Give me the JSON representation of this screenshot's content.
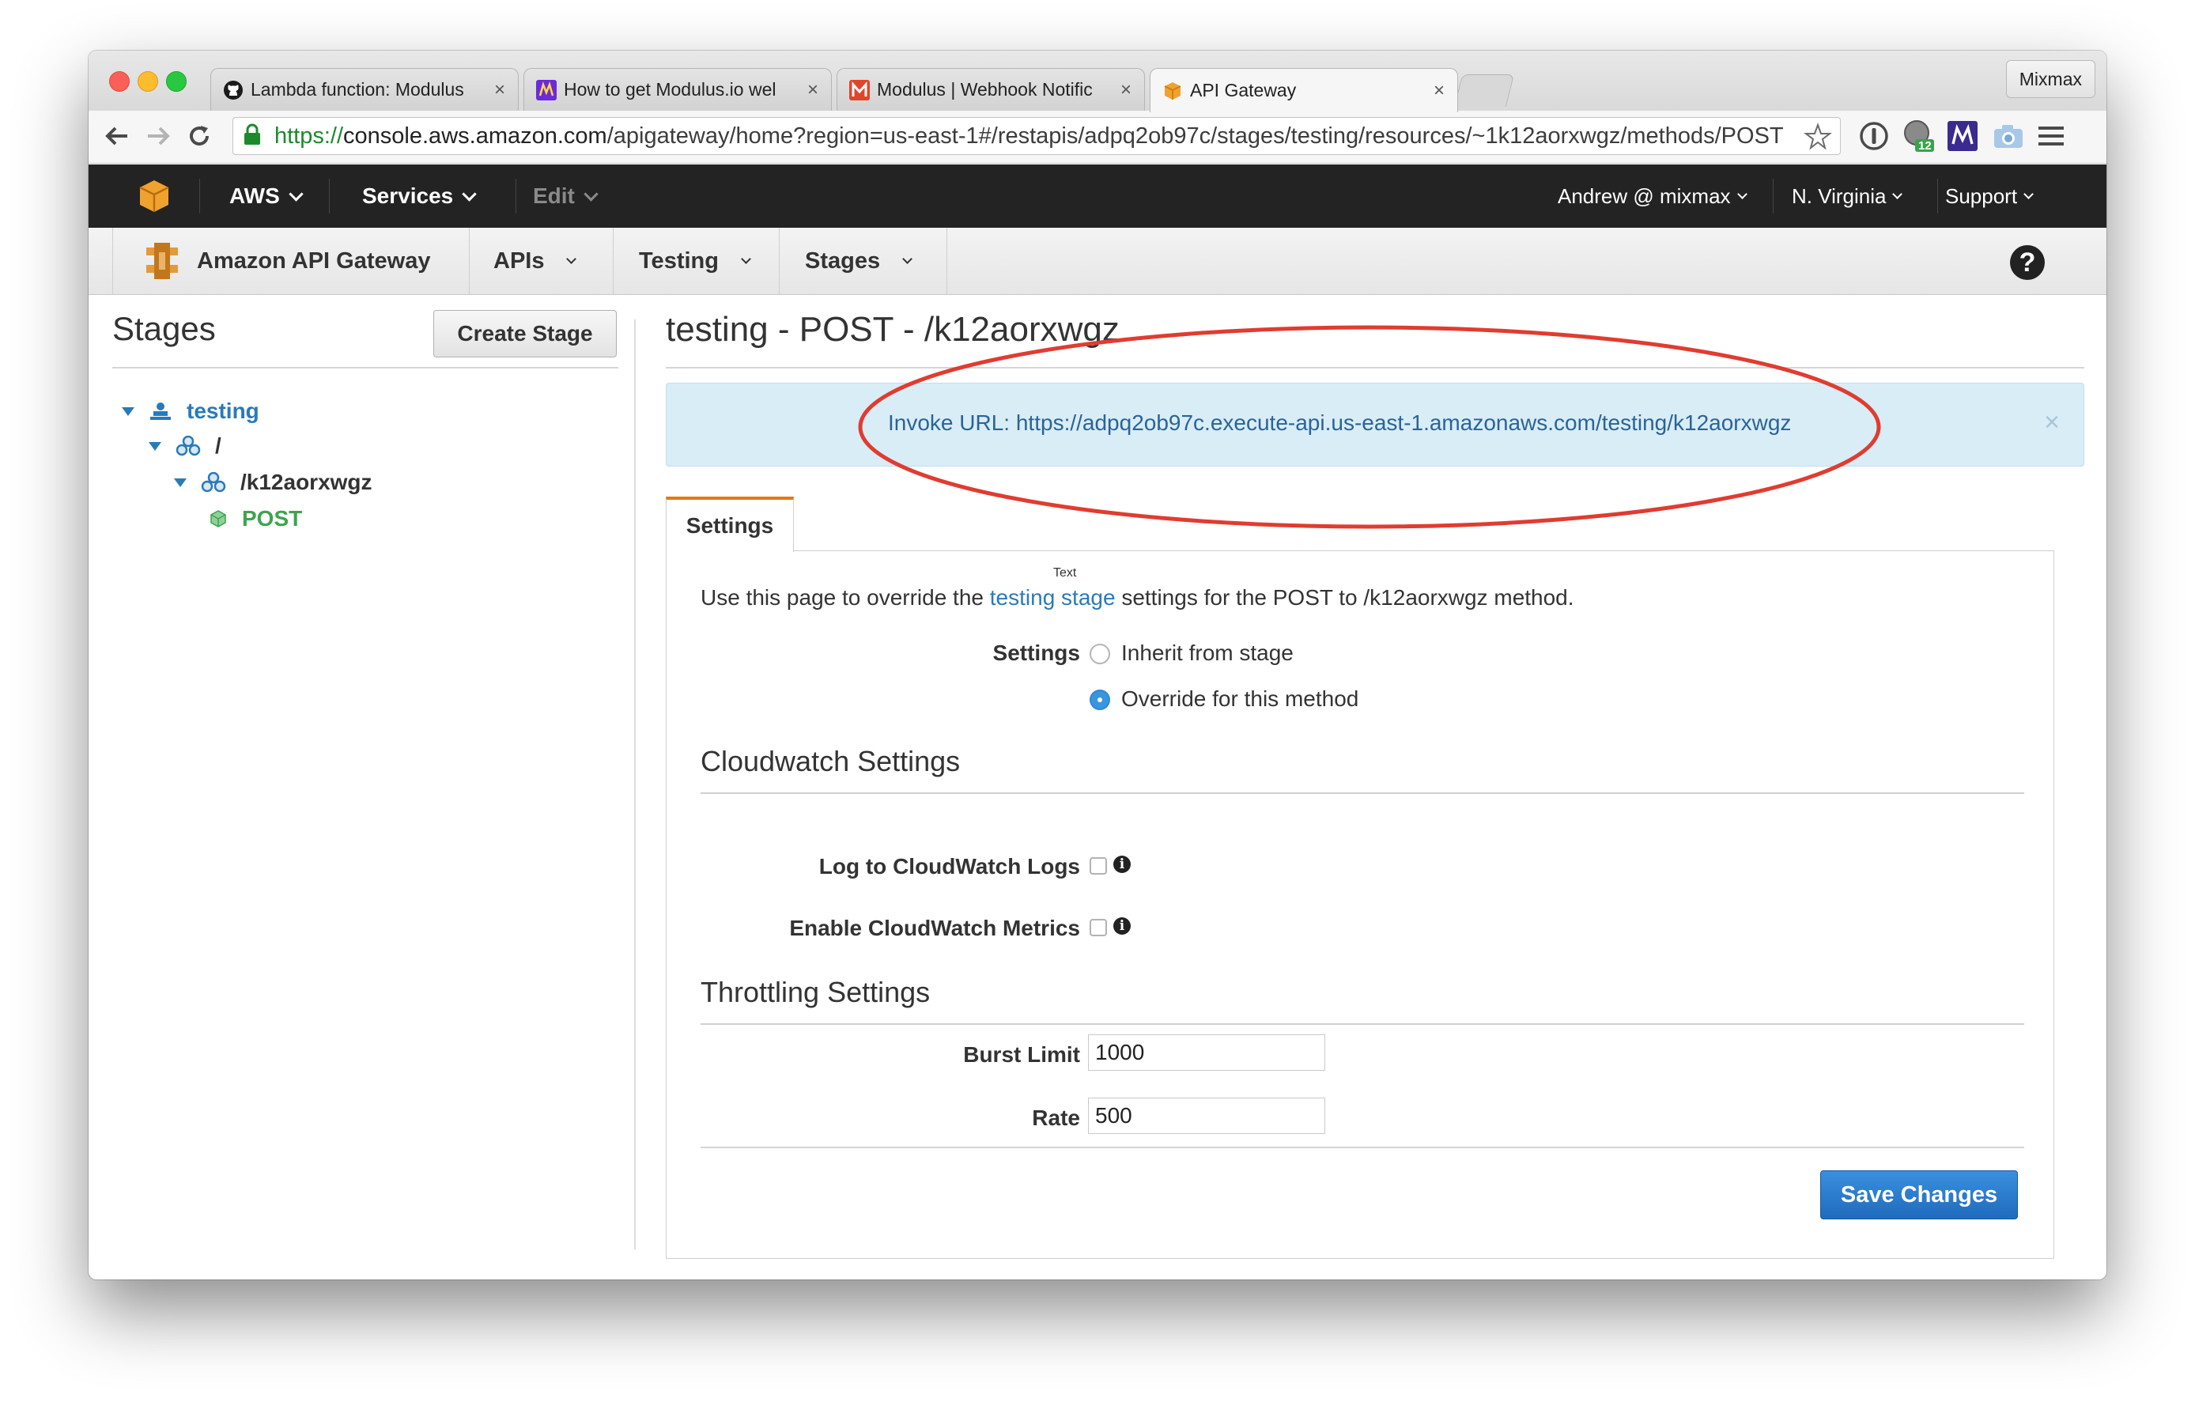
{
  "browser": {
    "tabs": [
      {
        "title": "Lambda function: Modulus",
        "favicon": "github-icon"
      },
      {
        "title": "How to get Modulus.io wel",
        "favicon": "mixmax-icon"
      },
      {
        "title": "Modulus | Webhook Notific",
        "favicon": "modulus-icon"
      },
      {
        "title": "API Gateway",
        "favicon": "aws-box-icon"
      }
    ],
    "close_glyph": "×",
    "profile": "Mixmax",
    "url_scheme": "https://",
    "url_host": "console.aws.amazon.com",
    "url_path": "/apigateway/home?region=us-east-1#/restapis/adpq2ob97c/stages/testing/resources/~1k12aorxwgz/methods/POST",
    "extension_badge": "12"
  },
  "aws_nav": {
    "logo": "aws-logo-icon",
    "aws": "AWS",
    "services": "Services",
    "edit": "Edit",
    "user": "Andrew @ mixmax",
    "region": "N. Virginia",
    "support": "Support"
  },
  "service_nav": {
    "name": "Amazon API Gateway",
    "apis": "APIs",
    "testing": "Testing",
    "stages": "Stages",
    "help": "?"
  },
  "sidebar": {
    "title": "Stages",
    "create_button": "Create Stage",
    "tree": {
      "stage": "testing",
      "root": "/",
      "resource": "/k12aorxwgz",
      "method": "POST"
    }
  },
  "main": {
    "title": "testing - POST - /k12aorxwgz",
    "invoke_label": "Invoke URL:",
    "invoke_url": "https://adpq2ob97c.execute-api.us-east-1.amazonaws.com/testing/k12aorxwgz",
    "dismiss": "×",
    "tab": "Settings",
    "tooltip_label": "Text",
    "description": {
      "before": "Use this page to override the ",
      "link": "testing stage",
      "after": " settings for the POST to /k12aorxwgz method."
    },
    "settings_label": "Settings",
    "radio_inherit": "Inherit from stage",
    "radio_override": "Override for this method",
    "selected_radio": "override",
    "cloudwatch_heading": "Cloudwatch Settings",
    "log_label": "Log to CloudWatch Logs",
    "log_checked": false,
    "metrics_label": "Enable CloudWatch Metrics",
    "metrics_checked": false,
    "info_glyph": "i",
    "throttling_heading": "Throttling Settings",
    "burst_label": "Burst Limit",
    "burst_value": "1000",
    "rate_label": "Rate",
    "rate_value": "500",
    "save_button": "Save Changes"
  },
  "colors": {
    "aws_bar": "#232323",
    "link": "#2a7ab8",
    "post_green": "#3fa34d",
    "alert_bg": "#d9edf7",
    "annotation_red": "#e03c31",
    "primary_button": "#1f6bbd",
    "tab_accent": "#e47911"
  }
}
